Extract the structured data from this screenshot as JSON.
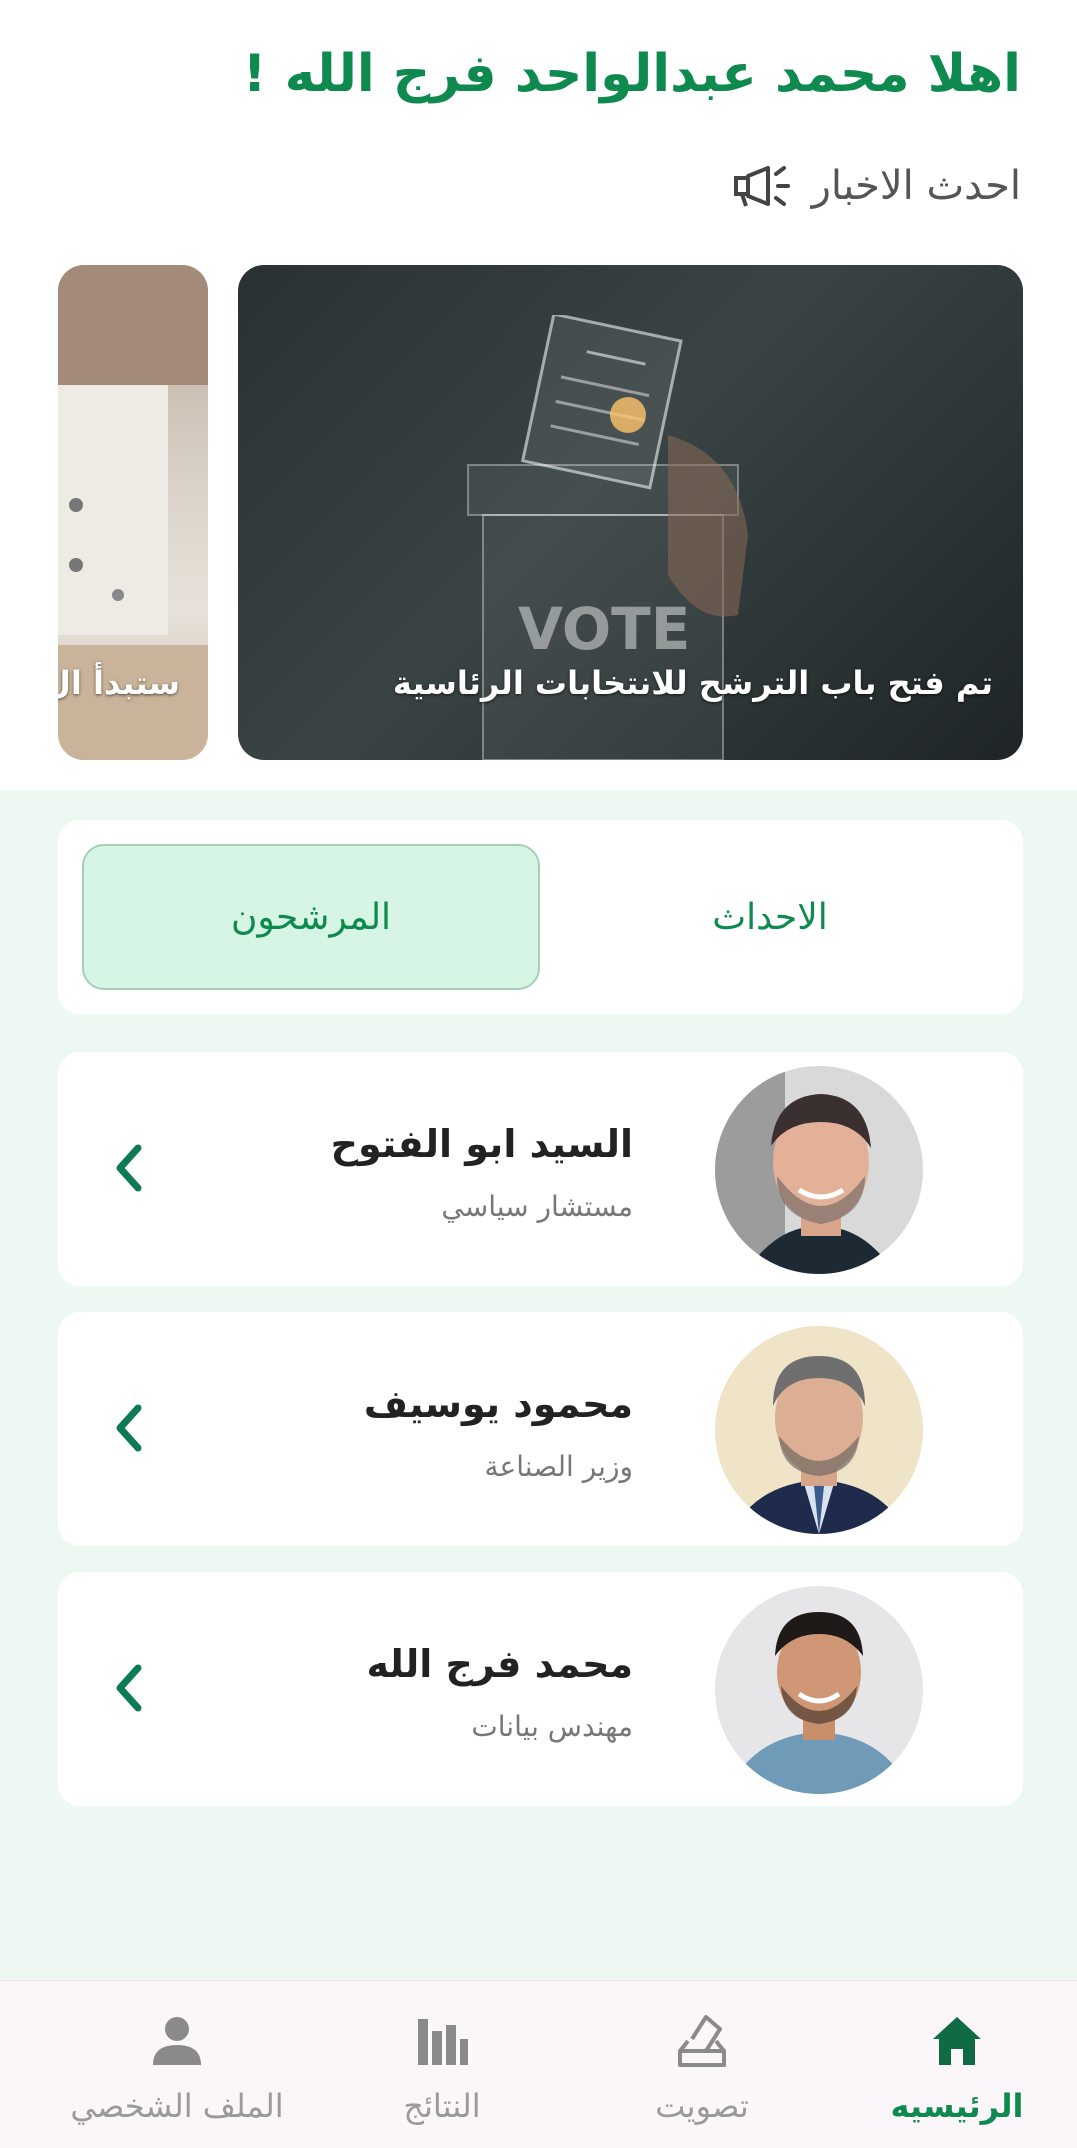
{
  "header": {
    "greeting": "اهلا  محمد عبدالواحد فرج الله !",
    "news_title": "احدث الاخبار"
  },
  "news": [
    {
      "caption": "تم فتح باب الترشح للانتخابات الرئاسية",
      "image_text": "VOTE"
    },
    {
      "caption": "ستبدأ ال"
    }
  ],
  "tabs": {
    "events": "الاحداث",
    "candidates": "المرشحون"
  },
  "candidates": [
    {
      "name": "السيد ابو الفتوح",
      "role": "مستشار سياسي"
    },
    {
      "name": "محمود يوسيف",
      "role": "وزير الصناعة"
    },
    {
      "name": "محمد فرج الله",
      "role": "مهندس بيانات"
    }
  ],
  "nav": {
    "home": "الرئيسيه",
    "vote": "تصويت",
    "results": "النتائج",
    "profile": "الملف الشخصي"
  },
  "colors": {
    "accent": "#0e8a4f",
    "section_bg": "#eef8f2",
    "selected_tab": "#d6f5e4"
  }
}
